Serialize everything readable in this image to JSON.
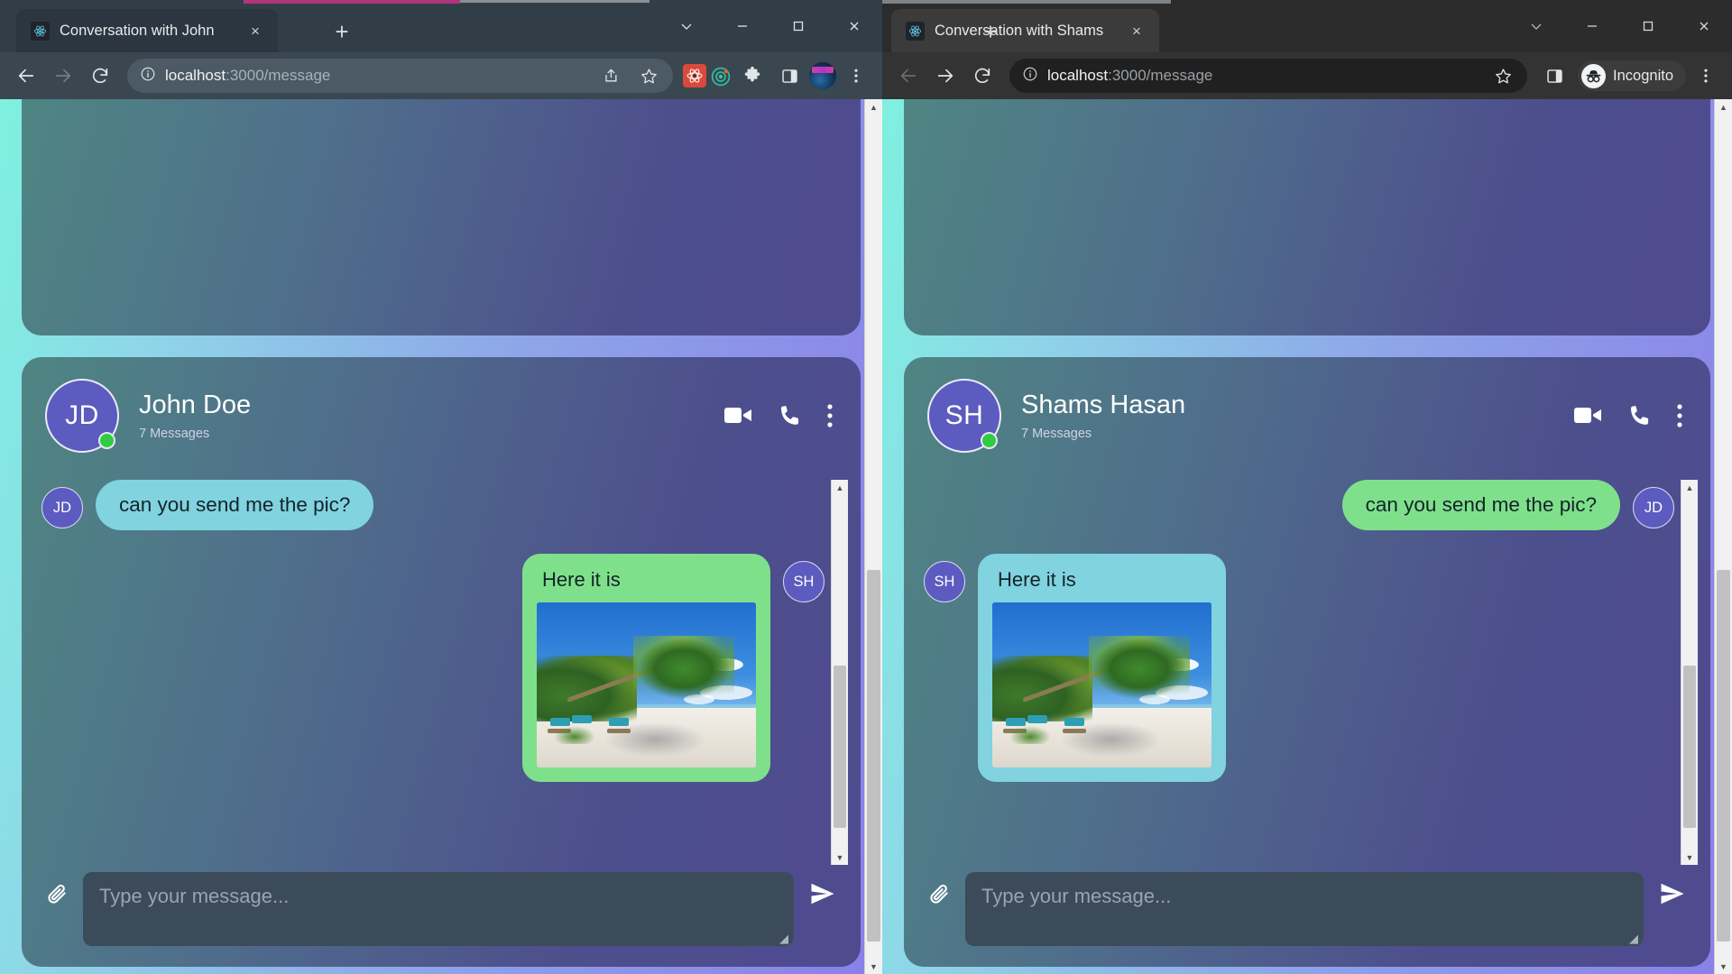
{
  "windows": [
    {
      "id": "left",
      "mode": "normal",
      "tab": {
        "title": "Conversation with John",
        "favicon": "react-icon",
        "close": "×",
        "new_tab": "+"
      },
      "omnibox": {
        "info_icon": "site-info-icon",
        "url_host": "localhost",
        "url_path": ":3000/message",
        "share_icon": "share-icon",
        "bookmark_icon": "star-icon",
        "ext_react_icon": "react-extension-icon",
        "ext_target_icon": "target-extension-icon",
        "puzzle_icon": "extensions-puzzle-icon",
        "sidebar_icon": "side-panel-icon",
        "profile_icon": "profile-avatar-icon",
        "menu_icon": "browser-menu-icon"
      },
      "nav": {
        "back": "back-arrow-icon",
        "forward": "forward-arrow-icon",
        "reload": "reload-icon"
      },
      "window_controls": {
        "chevron": "tab-search-icon",
        "minimize": "−",
        "maximize": "□",
        "close": "×"
      },
      "chat": {
        "avatar_initials": "JD",
        "name": "John Doe",
        "message_count": "7 Messages",
        "status": "online",
        "actions": {
          "video": "video-call-icon",
          "phone": "phone-call-icon",
          "more": "more-options-icon"
        },
        "messages": [
          {
            "side": "left",
            "avatar": "JD",
            "bubble": "cyan",
            "text": "can you send me the pic?",
            "has_image": false
          },
          {
            "side": "right",
            "avatar": "SH",
            "bubble": "green",
            "text": "Here it is",
            "has_image": true,
            "image_alt": "beach-palm-tree-photo"
          }
        ],
        "composer": {
          "attach_icon": "paperclip-icon",
          "placeholder": "Type your message...",
          "value": "",
          "send_icon": "send-icon"
        }
      }
    },
    {
      "id": "right",
      "mode": "incognito",
      "tab": {
        "title": "Conversation with Shams",
        "favicon": "react-icon",
        "close": "×",
        "new_tab": "+"
      },
      "omnibox": {
        "info_icon": "site-info-icon",
        "url_host": "localhost",
        "url_path": ":3000/message",
        "bookmark_icon": "star-icon",
        "sidebar_icon": "side-panel-icon",
        "incognito_label": "Incognito",
        "menu_icon": "browser-menu-icon"
      },
      "nav": {
        "back": "back-arrow-icon",
        "forward": "forward-arrow-icon",
        "reload": "reload-icon"
      },
      "window_controls": {
        "chevron": "tab-search-icon",
        "minimize": "−",
        "maximize": "□",
        "close": "×"
      },
      "chat": {
        "avatar_initials": "SH",
        "name": "Shams Hasan",
        "message_count": "7 Messages",
        "status": "online",
        "actions": {
          "video": "video-call-icon",
          "phone": "phone-call-icon",
          "more": "more-options-icon"
        },
        "messages": [
          {
            "side": "right",
            "avatar": "JD",
            "bubble": "green",
            "text": "can you send me the pic?",
            "has_image": false
          },
          {
            "side": "left",
            "avatar": "SH",
            "bubble": "cyan",
            "text": "Here it is",
            "has_image": true,
            "image_alt": "beach-palm-tree-photo"
          }
        ],
        "composer": {
          "attach_icon": "paperclip-icon",
          "placeholder": "Type your message...",
          "value": "",
          "send_icon": "send-icon"
        }
      }
    }
  ],
  "colors": {
    "bubble_cyan": "#80d3df",
    "bubble_green": "#7fe08b",
    "avatar_purple": "#5b5bc0",
    "online_green": "#2fcc41",
    "page_gradient_start": "#7ff0e0",
    "page_gradient_end": "#8a7fe8",
    "card_gradient_start": "#4f8583",
    "card_gradient_end": "#4e4b8e"
  }
}
